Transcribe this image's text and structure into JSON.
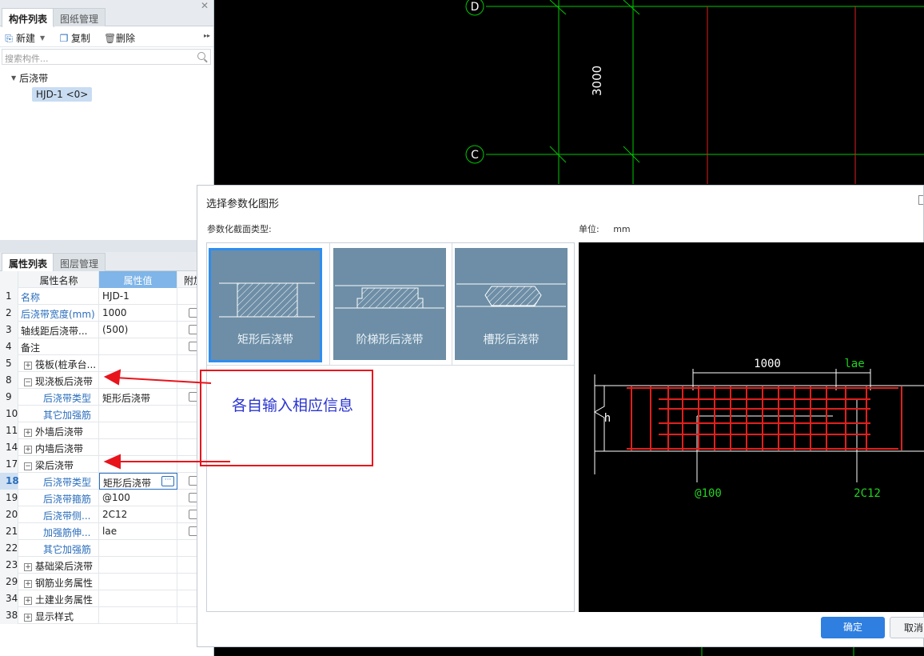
{
  "component_panel": {
    "tabs": [
      "构件列表",
      "图纸管理"
    ],
    "toolbar": {
      "new": "新建",
      "copy": "复制",
      "delete": "删除"
    },
    "search_placeholder": "搜索构件...",
    "tree_root": "后浇带",
    "tree_child": "HJD-1 <0>"
  },
  "property_panel": {
    "tabs": [
      "属性列表",
      "图层管理"
    ],
    "headers": {
      "name": "属性名称",
      "value": "属性值",
      "extra": "附加"
    },
    "rows": [
      {
        "num": "1",
        "name": "名称",
        "value": "HJD-1",
        "blue": true,
        "check": false,
        "expand": "",
        "indent": false
      },
      {
        "num": "2",
        "name": "后浇带宽度(mm)",
        "value": "1000",
        "blue": true,
        "check": true,
        "expand": "",
        "indent": false
      },
      {
        "num": "3",
        "name": "轴线距后浇带...",
        "value": "(500)",
        "blue": false,
        "check": true,
        "expand": "",
        "indent": false
      },
      {
        "num": "4",
        "name": "备注",
        "value": "",
        "blue": false,
        "check": true,
        "expand": "",
        "indent": false
      },
      {
        "num": "5",
        "name": "筏板(桩承台...",
        "value": "",
        "blue": false,
        "check": false,
        "expand": "+",
        "indent": false
      },
      {
        "num": "8",
        "name": "现浇板后浇带",
        "value": "",
        "blue": false,
        "check": false,
        "expand": "-",
        "indent": false
      },
      {
        "num": "9",
        "name": "后浇带类型",
        "value": "矩形后浇带",
        "blue": true,
        "check": true,
        "expand": "",
        "indent": true
      },
      {
        "num": "10",
        "name": "其它加强筋",
        "value": "",
        "blue": true,
        "check": false,
        "expand": "",
        "indent": true
      },
      {
        "num": "11",
        "name": "外墙后浇带",
        "value": "",
        "blue": false,
        "check": false,
        "expand": "+",
        "indent": false
      },
      {
        "num": "14",
        "name": "内墙后浇带",
        "value": "",
        "blue": false,
        "check": false,
        "expand": "+",
        "indent": false
      },
      {
        "num": "17",
        "name": "梁后浇带",
        "value": "",
        "blue": false,
        "check": false,
        "expand": "-",
        "indent": false
      },
      {
        "num": "18",
        "name": "后浇带类型",
        "value": "矩形后浇带",
        "blue": true,
        "check": true,
        "expand": "",
        "indent": true,
        "selected": true
      },
      {
        "num": "19",
        "name": "后浇带箍筋",
        "value": "@100",
        "blue": true,
        "check": true,
        "expand": "",
        "indent": true
      },
      {
        "num": "20",
        "name": "后浇带侧...",
        "value": "2C12",
        "blue": true,
        "check": true,
        "expand": "",
        "indent": true
      },
      {
        "num": "21",
        "name": "加强筋伸...",
        "value": "lae",
        "blue": true,
        "check": true,
        "expand": "",
        "indent": true
      },
      {
        "num": "22",
        "name": "其它加强筋",
        "value": "",
        "blue": true,
        "check": false,
        "expand": "",
        "indent": true
      },
      {
        "num": "23",
        "name": "基础梁后浇带",
        "value": "",
        "blue": false,
        "check": false,
        "expand": "+",
        "indent": false
      },
      {
        "num": "29",
        "name": "钢筋业务属性",
        "value": "",
        "blue": false,
        "check": false,
        "expand": "+",
        "indent": false
      },
      {
        "num": "34",
        "name": "土建业务属性",
        "value": "",
        "blue": false,
        "check": false,
        "expand": "+",
        "indent": false
      },
      {
        "num": "38",
        "name": "显示样式",
        "value": "",
        "blue": false,
        "check": false,
        "expand": "+",
        "indent": false
      }
    ]
  },
  "cad": {
    "axis_d": "D",
    "axis_c": "C",
    "dimension": "3000",
    "line_color": "#00c800",
    "wall_color": "#e0201c"
  },
  "dialog": {
    "title": "选择参数化图形",
    "section_label": "参数化截面类型:",
    "unit_label": "单位:",
    "unit_value": "mm",
    "shapes": [
      {
        "name": "矩形后浇带",
        "selected": true
      },
      {
        "name": "阶梯形后浇带",
        "selected": false
      },
      {
        "name": "槽形后浇带",
        "selected": false
      }
    ],
    "preview": {
      "width_label": "1000",
      "lae_label": "lae",
      "h_label": "h",
      "stirrup_label": "@100",
      "bar_label": "2C12"
    },
    "ok": "确定",
    "cancel": "取消"
  },
  "annotation": {
    "text": "各自输入相应信息",
    "color": "#e8141c"
  }
}
